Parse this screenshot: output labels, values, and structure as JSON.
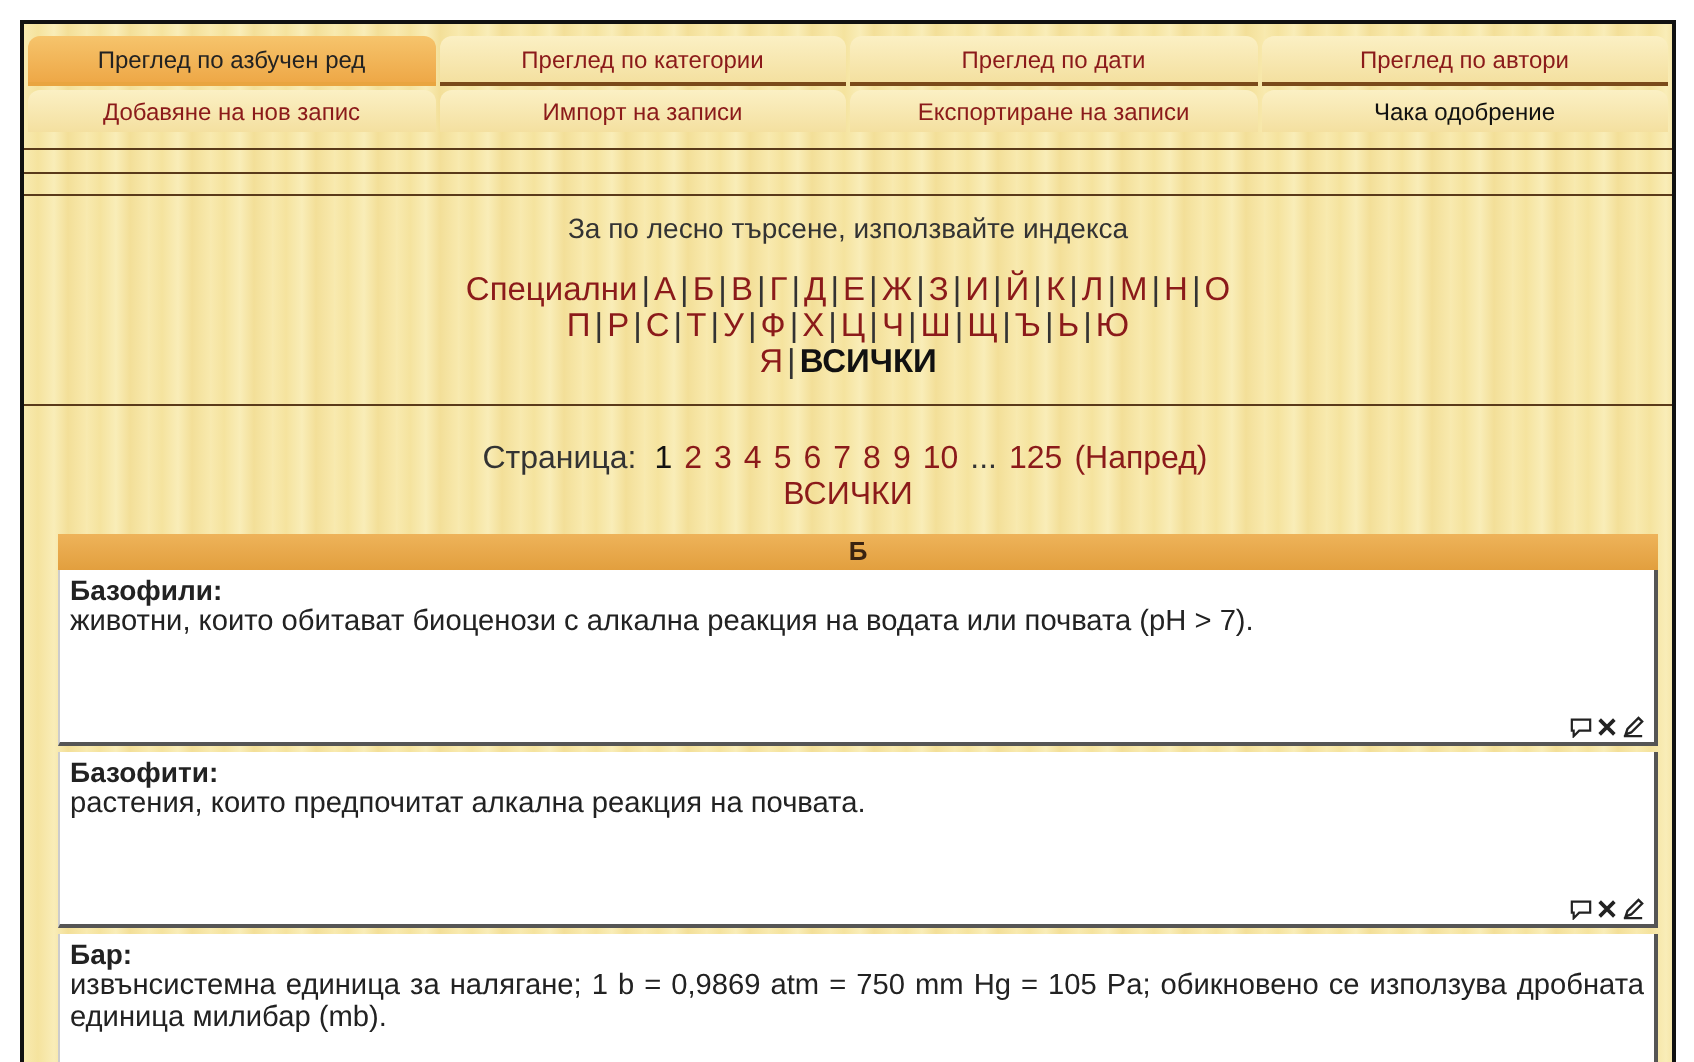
{
  "tabs": [
    {
      "label": "Преглед по азбучен ред",
      "selected": true
    },
    {
      "label": "Преглед по категории",
      "selected": false
    },
    {
      "label": "Преглед по дати",
      "selected": false
    },
    {
      "label": "Преглед по автори",
      "selected": false
    }
  ],
  "actions": [
    {
      "label": "Добавяне на нов запис",
      "color": "#8b1a1a"
    },
    {
      "label": "Импорт на записи",
      "color": "#8b1a1a"
    },
    {
      "label": "Експортиране на записи",
      "color": "#8b1a1a"
    },
    {
      "label": "Чака одобрение",
      "color": "#111111"
    }
  ],
  "index_hint": "За по лесно търсене, използвайте индекса",
  "separator": "|",
  "index_rows": [
    [
      {
        "label": "Специални",
        "selected": false
      },
      {
        "label": "А",
        "selected": false
      },
      {
        "label": "Б",
        "selected": false
      },
      {
        "label": "В",
        "selected": false
      },
      {
        "label": "Г",
        "selected": false
      },
      {
        "label": "Д",
        "selected": false
      },
      {
        "label": "Е",
        "selected": false
      },
      {
        "label": "Ж",
        "selected": false
      },
      {
        "label": "З",
        "selected": false
      },
      {
        "label": "И",
        "selected": false
      },
      {
        "label": "Й",
        "selected": false
      },
      {
        "label": "К",
        "selected": false
      },
      {
        "label": "Л",
        "selected": false
      },
      {
        "label": "М",
        "selected": false
      },
      {
        "label": "Н",
        "selected": false
      },
      {
        "label": "О",
        "selected": false
      }
    ],
    [
      {
        "label": "П",
        "selected": false
      },
      {
        "label": "Р",
        "selected": false
      },
      {
        "label": "С",
        "selected": false
      },
      {
        "label": "Т",
        "selected": false
      },
      {
        "label": "У",
        "selected": false
      },
      {
        "label": "Ф",
        "selected": false
      },
      {
        "label": "Х",
        "selected": false
      },
      {
        "label": "Ц",
        "selected": false
      },
      {
        "label": "Ч",
        "selected": false
      },
      {
        "label": "Ш",
        "selected": false
      },
      {
        "label": "Щ",
        "selected": false
      },
      {
        "label": "Ъ",
        "selected": false
      },
      {
        "label": "Ь",
        "selected": false
      },
      {
        "label": "Ю",
        "selected": false
      }
    ],
    [
      {
        "label": "Я",
        "selected": false
      },
      {
        "label": "ВСИЧКИ",
        "selected": true
      }
    ]
  ],
  "pagination": {
    "label": "Страница:",
    "pages": [
      {
        "label": "1",
        "selected": true
      },
      {
        "label": "2",
        "selected": false
      },
      {
        "label": "3",
        "selected": false
      },
      {
        "label": "4",
        "selected": false
      },
      {
        "label": "5",
        "selected": false
      },
      {
        "label": "6",
        "selected": false
      },
      {
        "label": "7",
        "selected": false
      },
      {
        "label": "8",
        "selected": false
      },
      {
        "label": "9",
        "selected": false
      },
      {
        "label": "10",
        "selected": false
      }
    ],
    "ellipsis": "...",
    "last": "125",
    "next": "(Напред)",
    "all": "ВСИЧКИ"
  },
  "section": "Б",
  "entries": [
    {
      "term": "Базофили:",
      "definition": "животни, които обитават биоценози с алкална реакция на водата или почвата (pH > 7).",
      "tools": true
    },
    {
      "term": "Базофити:",
      "definition": "растения, които предпочитат алкална реакция на почвата.",
      "tools": true
    },
    {
      "term": "Бар:",
      "definition": "извънсистемна единица за налягане; 1 b = 0,9869 atm = 750 mm Hg = 105 Pa; обикновено се използува дробната единица милибар (mb)."
    }
  ]
}
